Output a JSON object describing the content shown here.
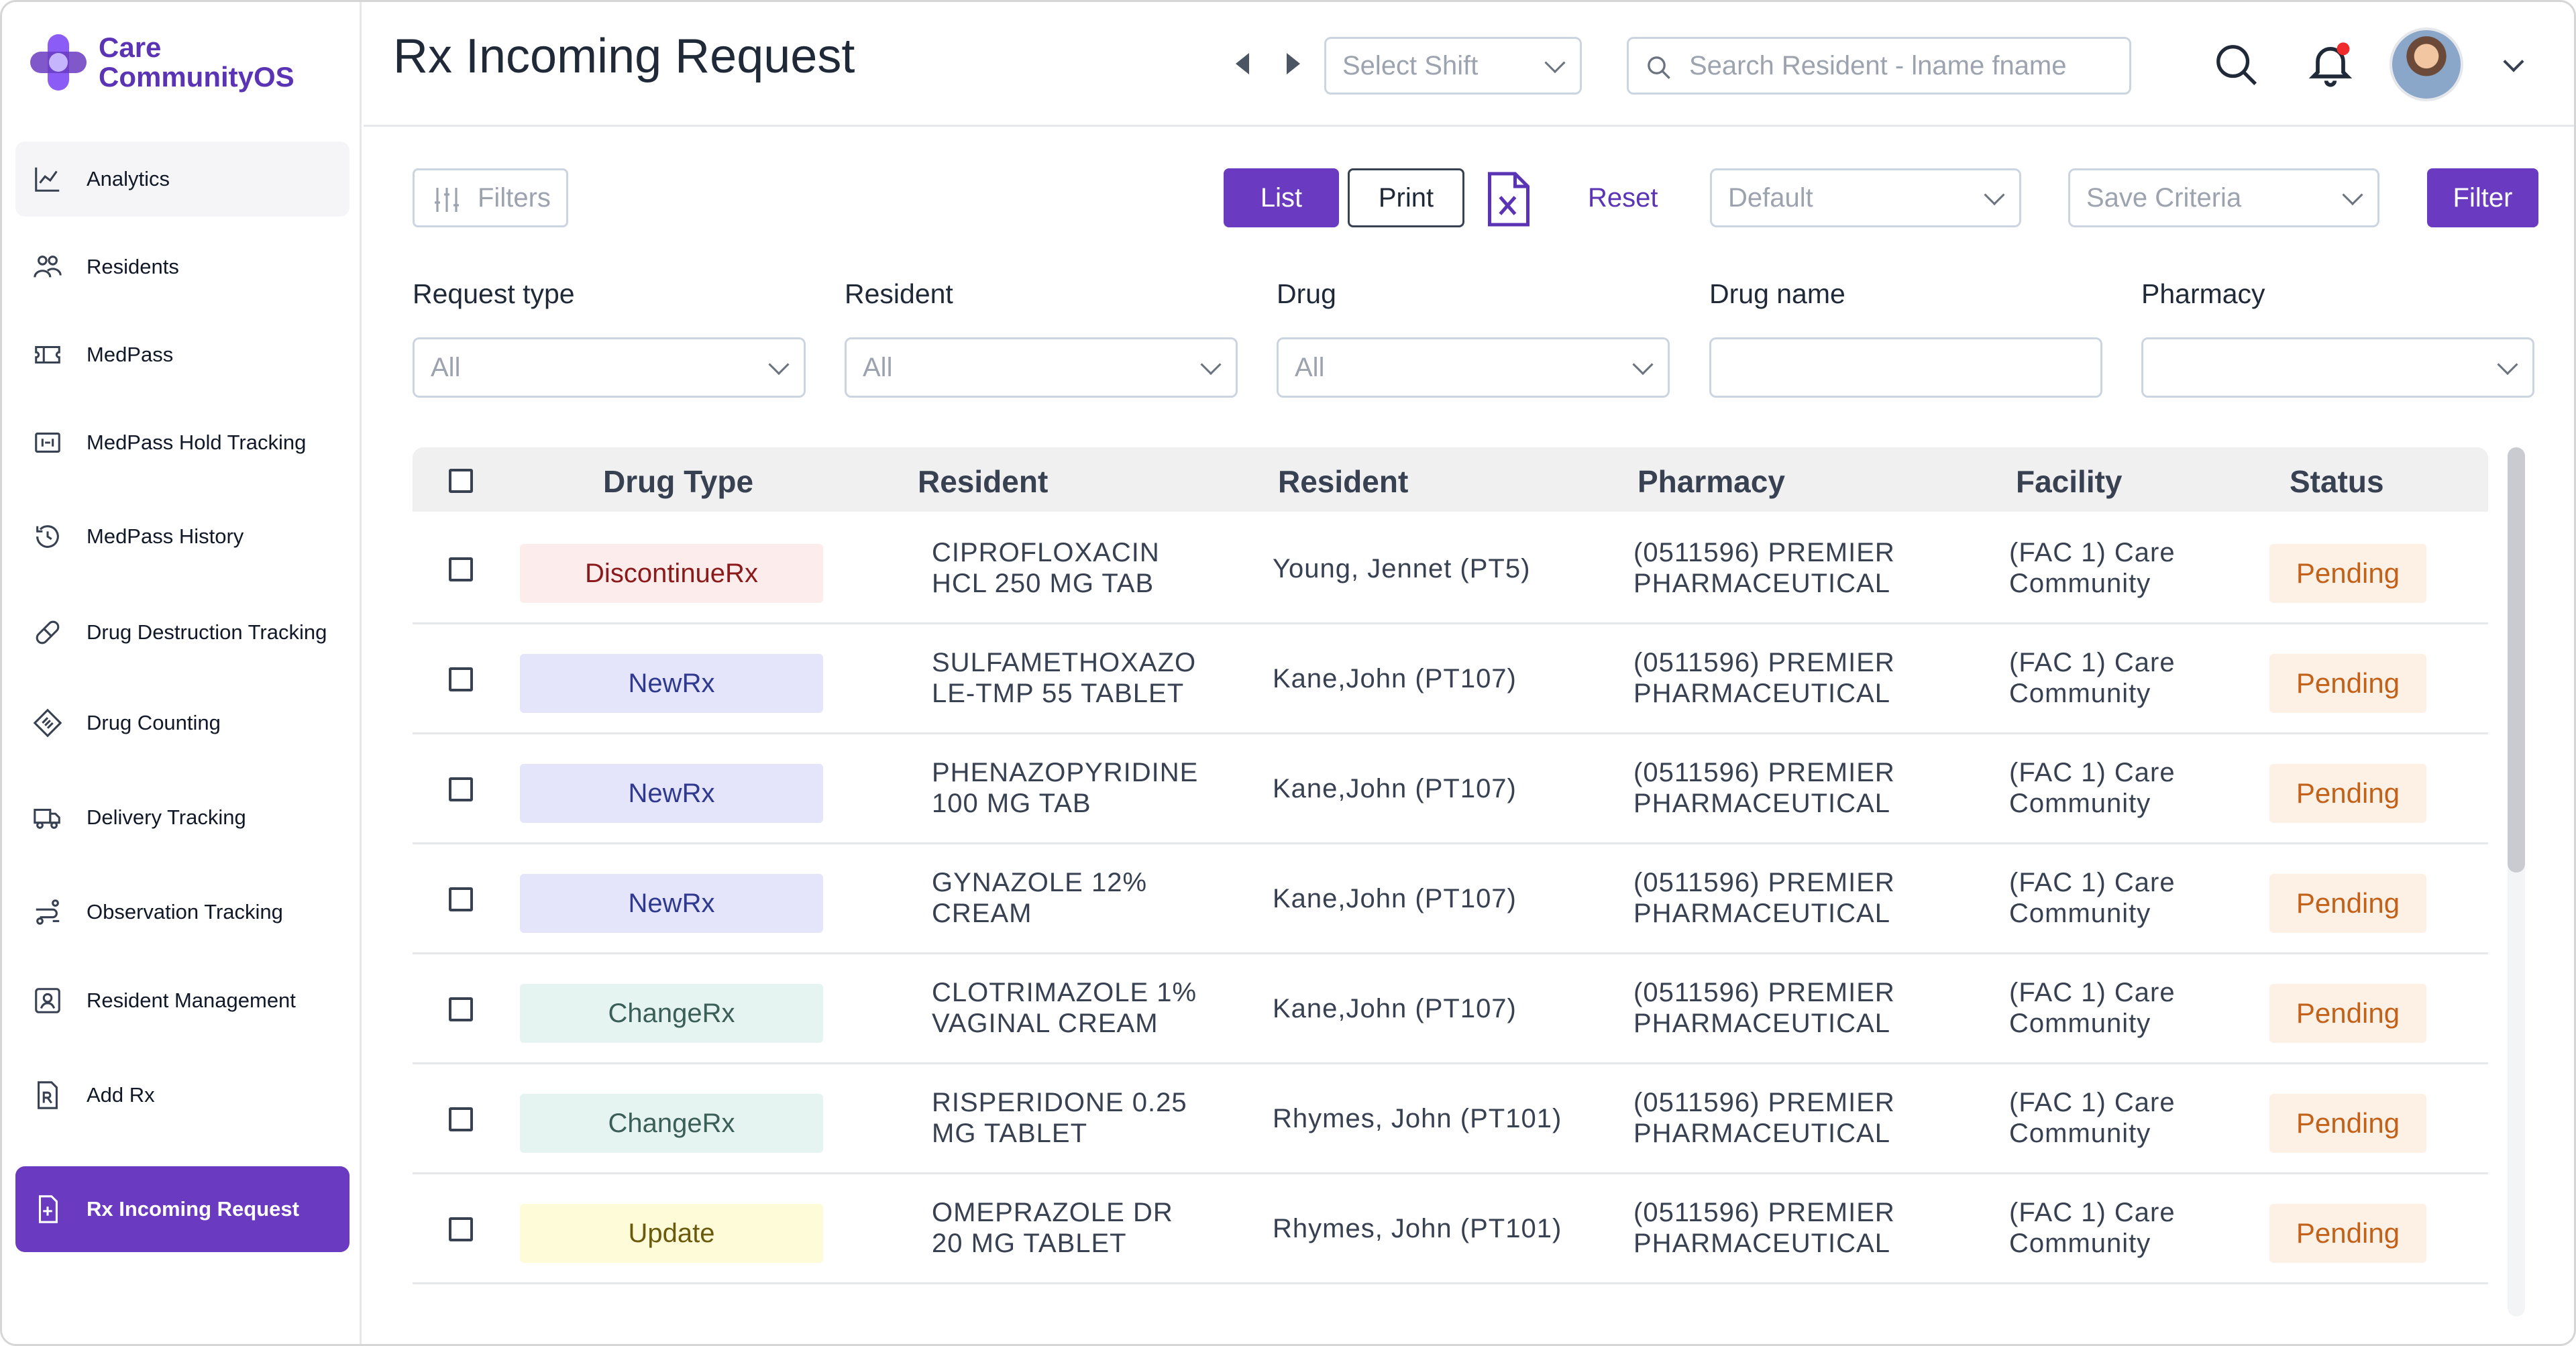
{
  "brand": {
    "line1": "Care",
    "line2": "CommunityOS"
  },
  "sidebar": {
    "items": [
      {
        "label": "Analytics",
        "icon": "chart-line-icon"
      },
      {
        "label": "Residents",
        "icon": "users-icon"
      },
      {
        "label": "MedPass",
        "icon": "ticket-icon"
      },
      {
        "label": "MedPass Hold Tracking",
        "icon": "hold-tracking-icon"
      },
      {
        "label": "MedPass History",
        "icon": "history-icon"
      },
      {
        "label": "Drug Destruction Tracking",
        "icon": "pill-icon"
      },
      {
        "label": "Drug Counting",
        "icon": "tag-icon"
      },
      {
        "label": "Delivery Tracking",
        "icon": "truck-icon"
      },
      {
        "label": "Observation Tracking",
        "icon": "route-icon"
      },
      {
        "label": "Resident Management",
        "icon": "id-card-icon"
      },
      {
        "label": "Add Rx",
        "icon": "rx-document-icon"
      },
      {
        "label": "Rx Incoming Request",
        "icon": "file-plus-icon"
      }
    ]
  },
  "header": {
    "title": "Rx Incoming Request",
    "shift_placeholder": "Select Shift",
    "search_placeholder": "Search Resident - lname fname"
  },
  "toolbar": {
    "filters_label": "Filters",
    "list_label": "List",
    "print_label": "Print",
    "reset_label": "Reset",
    "criteria_default": "Default",
    "save_criteria": "Save Criteria",
    "filter_label": "Filter"
  },
  "filters": {
    "request_type": {
      "label": "Request type",
      "value": "All"
    },
    "resident": {
      "label": "Resident",
      "value": "All"
    },
    "drug": {
      "label": "Drug",
      "value": "All"
    },
    "drug_name": {
      "label": "Drug name",
      "value": ""
    },
    "pharmacy": {
      "label": "Pharmacy",
      "value": ""
    }
  },
  "table": {
    "columns": [
      "Drug Type",
      "Resident",
      "Resident",
      "Pharmacy",
      "Facility",
      "Status"
    ],
    "tag_colors": {
      "DiscontinueRx": {
        "bg": "#fdecec",
        "fg": "#8b1a1a"
      },
      "NewRx": {
        "bg": "#e4e4fb",
        "fg": "#2f3a8f"
      },
      "ChangeRx": {
        "bg": "#e6f4f1",
        "fg": "#3b5f58"
      },
      "Update": {
        "bg": "#fdfbd8",
        "fg": "#6b5a0b"
      }
    },
    "rows": [
      {
        "type": "DiscontinueRx",
        "drug_line1": "CIPROFLOXACIN",
        "drug_line2": "HCL 250 MG TAB",
        "resident": "Young, Jennet (PT5)",
        "pharmacy_line1": "(0511596) PREMIER",
        "pharmacy_line2": "PHARMACEUTICAL",
        "facility_line1": "(FAC 1) Care",
        "facility_line2": "Community",
        "status": "Pending"
      },
      {
        "type": "NewRx",
        "drug_line1": "SULFAMETHOXAZO",
        "drug_line2": "LE-TMP 55 TABLET",
        "resident": "Kane,John (PT107)",
        "pharmacy_line1": "(0511596) PREMIER",
        "pharmacy_line2": "PHARMACEUTICAL",
        "facility_line1": "(FAC 1) Care",
        "facility_line2": "Community",
        "status": "Pending"
      },
      {
        "type": "NewRx",
        "drug_line1": "PHENAZOPYRIDINE",
        "drug_line2": "100 MG TAB",
        "resident": "Kane,John (PT107)",
        "pharmacy_line1": "(0511596) PREMIER",
        "pharmacy_line2": "PHARMACEUTICAL",
        "facility_line1": "(FAC 1) Care",
        "facility_line2": "Community",
        "status": "Pending"
      },
      {
        "type": "NewRx",
        "drug_line1": "GYNAZOLE 12%",
        "drug_line2": "CREAM",
        "resident": "Kane,John (PT107)",
        "pharmacy_line1": "(0511596) PREMIER",
        "pharmacy_line2": "PHARMACEUTICAL",
        "facility_line1": "(FAC 1) Care",
        "facility_line2": "Community",
        "status": "Pending"
      },
      {
        "type": "ChangeRx",
        "drug_line1": "CLOTRIMAZOLE 1%",
        "drug_line2": "VAGINAL CREAM",
        "resident": "Kane,John (PT107)",
        "pharmacy_line1": "(0511596) PREMIER",
        "pharmacy_line2": "PHARMACEUTICAL",
        "facility_line1": "(FAC 1) Care",
        "facility_line2": "Community",
        "status": "Pending"
      },
      {
        "type": "ChangeRx",
        "drug_line1": "RISPERIDONE 0.25",
        "drug_line2": "MG TABLET",
        "resident": "Rhymes, John (PT101)",
        "pharmacy_line1": "(0511596) PREMIER",
        "pharmacy_line2": "PHARMACEUTICAL",
        "facility_line1": "(FAC 1) Care",
        "facility_line2": "Community",
        "status": "Pending"
      },
      {
        "type": "Update",
        "drug_line1": "OMEPRAZOLE DR",
        "drug_line2": "20 MG TABLET",
        "resident": "Rhymes, John (PT101)",
        "pharmacy_line1": "(0511596) PREMIER",
        "pharmacy_line2": "PHARMACEUTICAL",
        "facility_line1": "(FAC 1) Care",
        "facility_line2": "Community",
        "status": "Pending"
      }
    ]
  },
  "colors": {
    "accent": "#6a3bc1",
    "status_bg": "#fdf1e6",
    "status_fg": "#c2621a"
  }
}
